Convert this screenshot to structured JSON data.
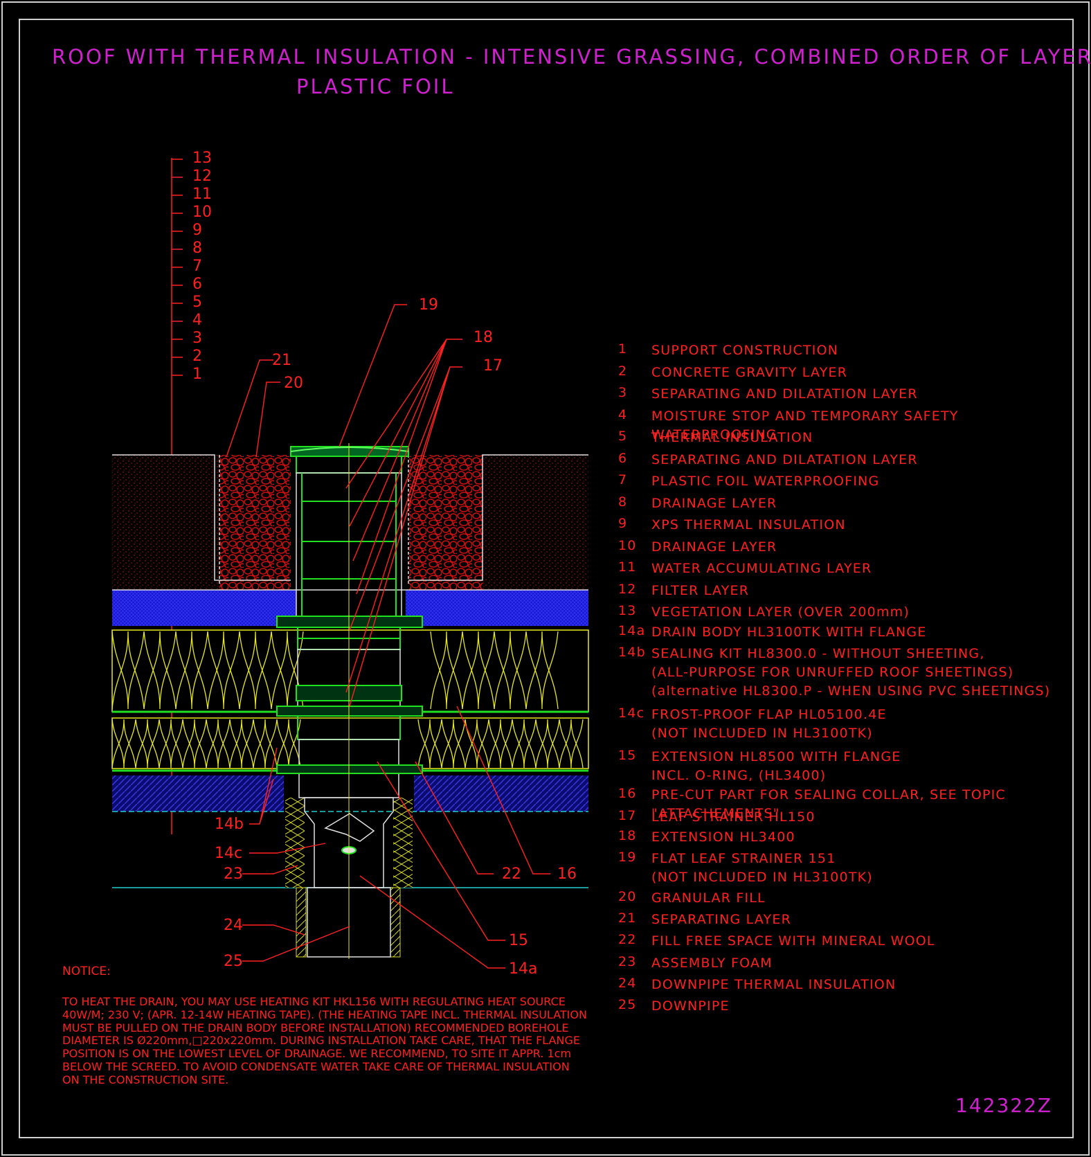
{
  "title": {
    "line1": "ROOF WITH THERMAL INSULATION - INTENSIVE GRASSING, COMBINED ORDER OF LAYERS",
    "line2": "PLASTIC FOIL"
  },
  "layer_scale": [
    "13",
    "12",
    "11",
    "10",
    "9",
    "8",
    "7",
    "6",
    "5",
    "4",
    "3",
    "2",
    "1"
  ],
  "callouts": {
    "c19": "19",
    "c18": "18",
    "c17": "17",
    "c21": "21",
    "c20": "20",
    "c14b": "14b",
    "c14c": "14c",
    "c23": "23",
    "c24": "24",
    "c25": "25",
    "c22": "22",
    "c16": "16",
    "c15": "15",
    "c14a": "14a"
  },
  "legend": [
    {
      "num": "1",
      "text": "SUPPORT CONSTRUCTION"
    },
    {
      "num": "2",
      "text": "CONCRETE GRAVITY LAYER"
    },
    {
      "num": "3",
      "text": "SEPARATING AND DILATATION LAYER"
    },
    {
      "num": "4",
      "text": "MOISTURE STOP AND TEMPORARY SAFETY WATERPROOFING"
    },
    {
      "num": "5",
      "text": "THERMAL INSULATION"
    },
    {
      "num": "6",
      "text": "SEPARATING AND DILATATION LAYER"
    },
    {
      "num": "7",
      "text": "PLASTIC FOIL WATERPROOFING"
    },
    {
      "num": "8",
      "text": "DRAINAGE LAYER"
    },
    {
      "num": "9",
      "text": "XPS THERMAL INSULATION"
    },
    {
      "num": "10",
      "text": "DRAINAGE LAYER"
    },
    {
      "num": "11",
      "text": "WATER ACCUMULATING LAYER"
    },
    {
      "num": "12",
      "text": "FILTER LAYER"
    },
    {
      "num": "13",
      "text": "VEGETATION LAYER (OVER 200mm)"
    },
    {
      "num": "14a",
      "text": "DRAIN BODY HL3100TK WITH FLANGE"
    },
    {
      "num": "14b",
      "text": "SEALING KIT HL8300.0 - WITHOUT SHEETING,\n(ALL-PURPOSE FOR UNRUFFED ROOF SHEETINGS)\n(alternative HL8300.P - WHEN USING PVC SHEETINGS)"
    },
    {
      "num": "14c",
      "text": "FROST-PROOF FLAP HL05100.4E\n(NOT INCLUDED IN HL3100TK)"
    },
    {
      "num": "15",
      "text": "EXTENSION HL8500 WITH FLANGE\nINCL. O-RING, (HL3400)"
    },
    {
      "num": "16",
      "text": "PRE-CUT PART FOR SEALING COLLAR, SEE TOPIC \"ATTACHEMENTS\""
    },
    {
      "num": "17",
      "text": "LEAF STRAINER HL150"
    },
    {
      "num": "18",
      "text": "EXTENSION HL3400"
    },
    {
      "num": "19",
      "text": "FLAT LEAF STRAINER 151\n(NOT INCLUDED IN HL3100TK)"
    },
    {
      "num": "20",
      "text": "GRANULAR FILL"
    },
    {
      "num": "21",
      "text": "SEPARATING LAYER"
    },
    {
      "num": "22",
      "text": "FILL FREE SPACE WITH MINERAL WOOL"
    },
    {
      "num": "23",
      "text": "ASSEMBLY FOAM"
    },
    {
      "num": "24",
      "text": "DOWNPIPE THERMAL INSULATION"
    },
    {
      "num": "25",
      "text": "DOWNPIPE"
    }
  ],
  "notice": {
    "heading": "NOTICE:",
    "body": "TO HEAT THE DRAIN, YOU MAY USE HEATING KIT HKL156 WITH REGULATING HEAT SOURCE 40W/M; 230 V;  (APR. 12-14W HEATING TAPE). (THE HEATING TAPE INCL. THERMAL INSULATION MUST BE PULLED ON THE DRAIN BODY BEFORE INSTALLATION) RECOMMENDED BOREHOLE DIAMETER IS Ø220mm,□220x220mm. DURING INSTALLATION TAKE CARE, THAT THE FLANGE POSITION IS ON THE LOWEST LEVEL OF DRAINAGE. WE RECOMMEND, TO SITE IT APPR. 1cm BELOW THE SCREED. TO AVOID CONDENSATE WATER TAKE CARE OF THERMAL INSULATION ON THE CONSTRUCTION SITE."
  },
  "drawing_code": "142322Z",
  "colors": {
    "background": "#000000",
    "title": "#d020d0",
    "annotation": "#ff2020",
    "fill_red": "#cc1010",
    "drainage_blue": "#1010e0",
    "insulation_yellow": "#e8e820",
    "drain_green": "#20e020",
    "line_cyan": "#20d0d0"
  }
}
